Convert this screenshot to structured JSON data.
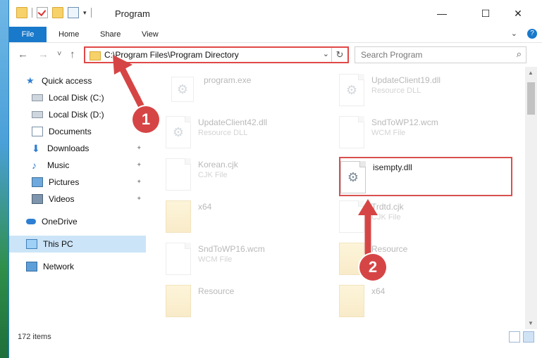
{
  "window": {
    "title": "Program",
    "controls": {
      "minimize": "—",
      "maximize": "☐",
      "close": "✕"
    }
  },
  "ribbon": {
    "tabs": [
      "File",
      "Home",
      "Share",
      "View"
    ],
    "expand_icon": "⌄",
    "help_icon": "?"
  },
  "navigation": {
    "back_icon": "←",
    "forward_icon": "→",
    "recent_icon": "˅",
    "up_icon": "↑",
    "address": "C:\\Program Files\\Program Directory",
    "address_dropdown": "⌄",
    "refresh_icon": "↻",
    "search_placeholder": "Search Program",
    "search_icon": "⌕"
  },
  "sidebar": {
    "items": [
      {
        "label": "Quick access",
        "icon": "star-icon"
      },
      {
        "label": "Local Disk (C:)",
        "icon": "drive-icon"
      },
      {
        "label": "Local Disk (D:)",
        "icon": "drive-icon"
      },
      {
        "label": "Documents",
        "icon": "documents-icon"
      },
      {
        "label": "Downloads",
        "icon": "download-icon"
      },
      {
        "label": "Music",
        "icon": "music-icon"
      },
      {
        "label": "Pictures",
        "icon": "pictures-icon"
      },
      {
        "label": "Videos",
        "icon": "videos-icon"
      },
      {
        "label": "OneDrive",
        "icon": "cloud-icon"
      },
      {
        "label": "This PC",
        "icon": "computer-icon"
      },
      {
        "label": "Network",
        "icon": "network-icon"
      }
    ],
    "pin_glyph": "✦"
  },
  "files": [
    {
      "name": "program.exe",
      "type": ""
    },
    {
      "name": "UpdateClient19.dll",
      "type": "Resource DLL"
    },
    {
      "name": "UpdateClient42.dll",
      "type": "Resource DLL"
    },
    {
      "name": "SndToWP12.wcm",
      "type": "WCM File"
    },
    {
      "name": "Korean.cjk",
      "type": "CJK File"
    },
    {
      "name": "isempty.dll",
      "type": ""
    },
    {
      "name": "x64",
      "type": ""
    },
    {
      "name": "Trdtd.cjk",
      "type": "CJK File"
    },
    {
      "name": "SndToWP16.wcm",
      "type": "WCM File"
    },
    {
      "name": "Resource",
      "type": ""
    },
    {
      "name": "Resource",
      "type": ""
    },
    {
      "name": "x64",
      "type": ""
    }
  ],
  "status": {
    "item_count": "172 items"
  },
  "callouts": [
    "1",
    "2"
  ],
  "colors": {
    "accent": "#1979ca",
    "highlight": "#e04848"
  }
}
